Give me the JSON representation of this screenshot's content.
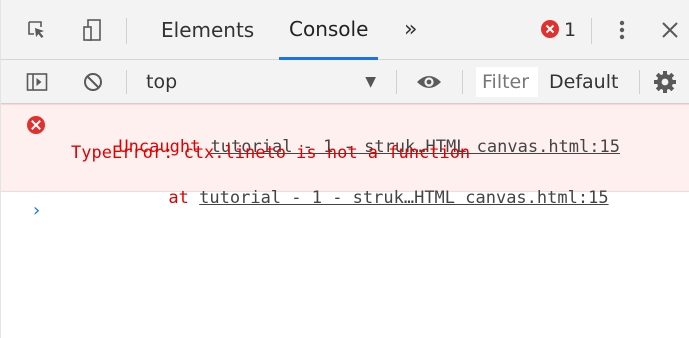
{
  "tabs": {
    "elements": "Elements",
    "console": "Console",
    "more": "»",
    "error_count": "1"
  },
  "toolbar": {
    "context": "top",
    "context_arrow": "▼",
    "filter_placeholder": "Filter",
    "levels": "Default"
  },
  "console": {
    "error_label": "Uncaught",
    "error_source": "tutorial - 1 - struk…HTML canvas.html:15",
    "error_message": "TypeError: ctx.lineto is not a function",
    "stack_at": "at",
    "stack_source": "tutorial - 1 - struk…HTML canvas.html:15",
    "prompt": "›"
  }
}
